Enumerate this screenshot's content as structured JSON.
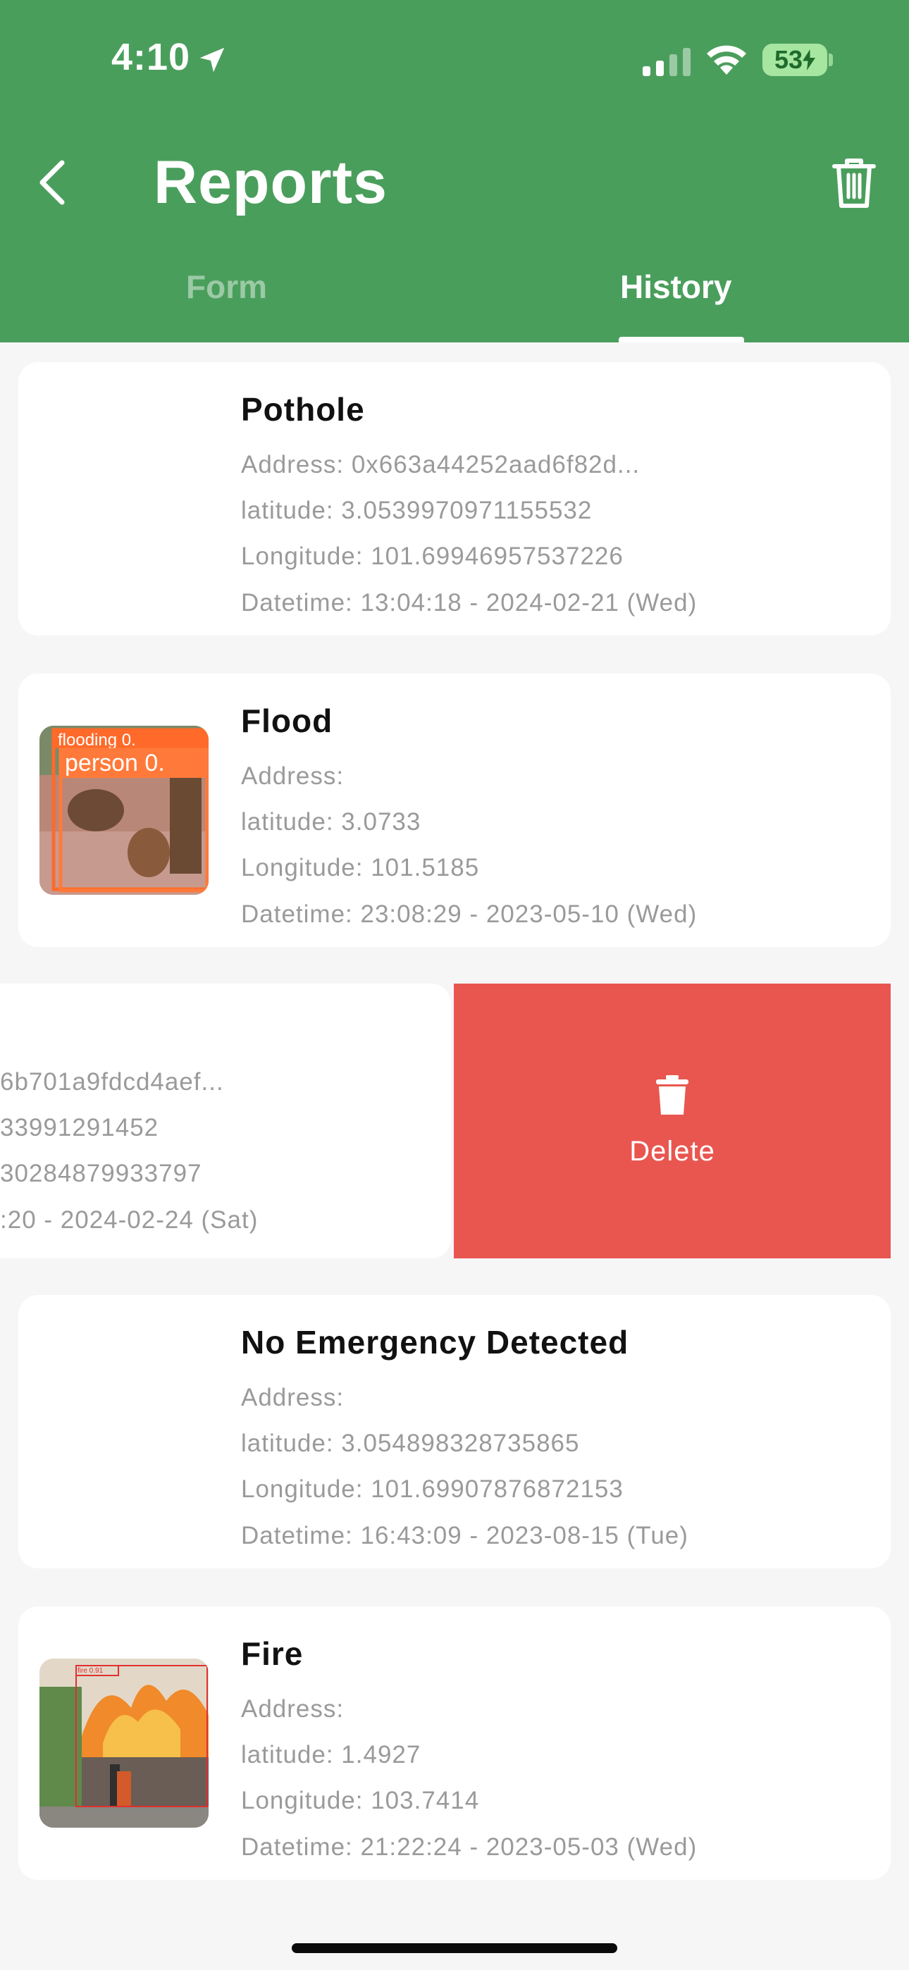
{
  "status_bar": {
    "time": "4:10",
    "battery": "53"
  },
  "header": {
    "title": "Reports"
  },
  "tabs": [
    {
      "label": "Form",
      "active": false
    },
    {
      "label": "History",
      "active": true
    }
  ],
  "reports": [
    {
      "title": "Pothole",
      "address": "Address: 0x663a44252aad6f82d...",
      "latitude": "latitude: 3.0539970971155532",
      "longitude": "Longitude: 101.69946957537226",
      "datetime": "Datetime: 13:04:18 - 2024-02-21 (Wed)"
    },
    {
      "title": "Flood",
      "address": "Address:",
      "latitude": "latitude: 3.0733",
      "longitude": "Longitude: 101.5185",
      "datetime": "Datetime: 23:08:29 - 2023-05-10 (Wed)",
      "thumb_labels": [
        "flooding 0.",
        "person 0."
      ]
    },
    {
      "address": "6b701a9fdcd4aef...",
      "latitude": "33991291452",
      "longitude": "30284879933797",
      "datetime": ":20 - 2024-02-24 (Sat)"
    },
    {
      "title": "No Emergency Detected",
      "address": "Address:",
      "latitude": "latitude: 3.054898328735865",
      "longitude": "Longitude: 101.69907876872153",
      "datetime": "Datetime: 16:43:09 - 2023-08-15 (Tue)"
    },
    {
      "title": "Fire",
      "address": "Address:",
      "latitude": "latitude: 1.4927",
      "longitude": "Longitude: 103.7414",
      "datetime": "Datetime: 21:22:24 - 2023-05-03 (Wed)",
      "thumb_labels": [
        "fire 0.91"
      ]
    }
  ],
  "delete_action": {
    "label": "Delete",
    "color": "#e95650"
  },
  "colors": {
    "header": "#4a9e5c",
    "background": "#f6f6f6"
  }
}
